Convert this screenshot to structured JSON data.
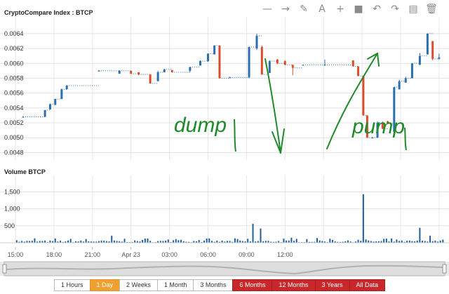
{
  "toolbar": {
    "icons": [
      "minus-icon",
      "arrow-right-icon",
      "pencil-icon",
      "text-icon",
      "plus-icon",
      "square-icon",
      "undo-icon",
      "redo-icon",
      "save-icon",
      "trash-icon"
    ],
    "glyphs": [
      "—",
      "→",
      "✎",
      "A",
      "+",
      "■",
      "↶",
      "↷",
      "▤",
      "🗑"
    ]
  },
  "price_panel": {
    "title": "CryptoCompare Index : BTCP"
  },
  "volume_panel": {
    "title": "Volume BTCP"
  },
  "annotations": {
    "left": "dump",
    "right": "pump"
  },
  "time_axis": [
    "15:00",
    "18:00",
    "21:00",
    "Apr 23",
    "03:00",
    "06:00",
    "09:00",
    "12:00"
  ],
  "range_buttons": [
    "1 Hours",
    "1 Day",
    "2 Weeks",
    "1 Month",
    "3 Months",
    "6 Months",
    "12 Months",
    "3 Years",
    "All Data"
  ],
  "active_range": "1 Day",
  "colors": {
    "up": "#2b6fb0",
    "down": "#dd4b2f",
    "volume": "#1f5f9e",
    "accent": "#f0a030",
    "range_long": "#c8282a",
    "annotation": "#1f8a2a"
  },
  "chart_data": [
    {
      "type": "candlestick",
      "title": "CryptoCompare Index : BTCP",
      "yticks": [
        "0.0048",
        "0.0050",
        "0.0052",
        "0.0054",
        "0.0056",
        "0.0058",
        "0.0060",
        "0.0062",
        "0.0064"
      ],
      "ylim": [
        0.0047,
        0.00655
      ],
      "x_hours": [
        -9,
        24.5
      ],
      "candles": [
        {
          "t": -8.4,
          "o": 0.00528,
          "c": 0.00528,
          "h": 0.00529,
          "l": 0.00527
        },
        {
          "t": -6.7,
          "o": 0.00528,
          "c": 0.00537,
          "h": 0.00537,
          "l": 0.00528
        },
        {
          "t": -6.3,
          "o": 0.00538,
          "c": 0.00545,
          "h": 0.00546,
          "l": 0.00538
        },
        {
          "t": -5.9,
          "o": 0.00544,
          "c": 0.00552,
          "h": 0.00552,
          "l": 0.00544
        },
        {
          "t": -5.4,
          "o": 0.00552,
          "c": 0.00565,
          "h": 0.00566,
          "l": 0.00552
        },
        {
          "t": -5.0,
          "o": 0.00565,
          "c": 0.0057,
          "h": 0.00571,
          "l": 0.00565
        },
        {
          "t": -2.5,
          "o": 0.0059,
          "c": 0.0059,
          "h": 0.00591,
          "l": 0.00589
        },
        {
          "t": -0.9,
          "o": 0.00586,
          "c": 0.0059,
          "h": 0.00591,
          "l": 0.00586
        },
        {
          "t": 0.0,
          "o": 0.0059,
          "c": 0.00586,
          "h": 0.0059,
          "l": 0.00586
        },
        {
          "t": 0.6,
          "o": 0.00588,
          "c": 0.00585,
          "h": 0.00588,
          "l": 0.00584
        },
        {
          "t": 1.5,
          "o": 0.00585,
          "c": 0.00573,
          "h": 0.00585,
          "l": 0.00573
        },
        {
          "t": 2.1,
          "o": 0.00576,
          "c": 0.00588,
          "h": 0.0059,
          "l": 0.00576
        },
        {
          "t": 2.6,
          "o": 0.00588,
          "c": 0.00592,
          "h": 0.00592,
          "l": 0.00588
        },
        {
          "t": 3.2,
          "o": 0.00591,
          "c": 0.00588,
          "h": 0.00591,
          "l": 0.00588
        },
        {
          "t": 4.6,
          "o": 0.0059,
          "c": 0.00595,
          "h": 0.00595,
          "l": 0.00588
        },
        {
          "t": 5.4,
          "o": 0.00597,
          "c": 0.00603,
          "h": 0.00604,
          "l": 0.00597
        },
        {
          "t": 6.0,
          "o": 0.00603,
          "c": 0.00613,
          "h": 0.00613,
          "l": 0.00602
        },
        {
          "t": 6.5,
          "o": 0.00612,
          "c": 0.00624,
          "h": 0.00624,
          "l": 0.00612
        },
        {
          "t": 6.9,
          "o": 0.00624,
          "c": 0.0058,
          "h": 0.00624,
          "l": 0.0058
        },
        {
          "t": 7.7,
          "o": 0.00581,
          "c": 0.00581,
          "h": 0.00582,
          "l": 0.00581
        },
        {
          "t": 9.2,
          "o": 0.00581,
          "c": 0.00622,
          "h": 0.00622,
          "l": 0.0058
        },
        {
          "t": 9.8,
          "o": 0.0062,
          "c": 0.00637,
          "h": 0.0064,
          "l": 0.00618
        },
        {
          "t": 10.2,
          "o": 0.00622,
          "c": 0.00585,
          "h": 0.00624,
          "l": 0.00585
        },
        {
          "t": 10.8,
          "o": 0.00587,
          "c": 0.00603,
          "h": 0.00604,
          "l": 0.00587
        },
        {
          "t": 11.4,
          "o": 0.00605,
          "c": 0.006,
          "h": 0.00606,
          "l": 0.00599
        },
        {
          "t": 12.0,
          "o": 0.00603,
          "c": 0.00598,
          "h": 0.00604,
          "l": 0.00598
        },
        {
          "t": 12.6,
          "o": 0.00598,
          "c": 0.00594,
          "h": 0.00598,
          "l": 0.00584
        },
        {
          "t": 13.4,
          "o": 0.00598,
          "c": 0.00598,
          "h": 0.00598,
          "l": 0.00597
        },
        {
          "t": 15.1,
          "o": 0.00598,
          "c": 0.00598,
          "h": 0.00605,
          "l": 0.00597
        },
        {
          "t": 17.3,
          "o": 0.00604,
          "c": 0.00596,
          "h": 0.00604,
          "l": 0.00596
        },
        {
          "t": 17.7,
          "o": 0.00596,
          "c": 0.00583,
          "h": 0.00596,
          "l": 0.00583
        },
        {
          "t": 18.1,
          "o": 0.00583,
          "c": 0.0053,
          "h": 0.00583,
          "l": 0.0053
        },
        {
          "t": 18.4,
          "o": 0.0053,
          "c": 0.005,
          "h": 0.0053,
          "l": 0.005
        },
        {
          "t": 18.8,
          "o": 0.005,
          "c": 0.005,
          "h": 0.00501,
          "l": 0.005
        },
        {
          "t": 19.2,
          "o": 0.005,
          "c": 0.0052,
          "h": 0.00522,
          "l": 0.005
        },
        {
          "t": 19.6,
          "o": 0.0052,
          "c": 0.00512,
          "h": 0.00522,
          "l": 0.00512
        },
        {
          "t": 20.0,
          "o": 0.00522,
          "c": 0.00519,
          "h": 0.00523,
          "l": 0.00518
        },
        {
          "t": 20.5,
          "o": 0.00508,
          "c": 0.00568,
          "h": 0.00568,
          "l": 0.00506
        },
        {
          "t": 20.9,
          "o": 0.00565,
          "c": 0.00576,
          "h": 0.00578,
          "l": 0.00565
        },
        {
          "t": 21.4,
          "o": 0.00574,
          "c": 0.0058,
          "h": 0.00582,
          "l": 0.00574
        },
        {
          "t": 21.9,
          "o": 0.0058,
          "c": 0.006,
          "h": 0.006,
          "l": 0.0058
        },
        {
          "t": 22.5,
          "o": 0.00598,
          "c": 0.0061,
          "h": 0.00614,
          "l": 0.00598
        },
        {
          "t": 23.1,
          "o": 0.00612,
          "c": 0.0064,
          "h": 0.0064,
          "l": 0.00612
        },
        {
          "t": 23.5,
          "o": 0.0063,
          "c": 0.00606,
          "h": 0.0063,
          "l": 0.00604
        },
        {
          "t": 24.0,
          "o": 0.00606,
          "c": 0.00608,
          "h": 0.00613,
          "l": 0.00605
        }
      ]
    },
    {
      "type": "bar",
      "title": "Volume BTCP",
      "yticks": [
        "500",
        "1,000",
        "1,500"
      ],
      "ylim": [
        0,
        1900
      ],
      "peaks": [
        [
          -7.5,
          130
        ],
        [
          -3.0,
          120
        ],
        [
          -1.5,
          210
        ],
        [
          2.0,
          160
        ],
        [
          4.0,
          180
        ],
        [
          6.0,
          400
        ],
        [
          6.6,
          330
        ],
        [
          8.0,
          230
        ],
        [
          9.5,
          560
        ],
        [
          10.1,
          420
        ],
        [
          10.6,
          230
        ],
        [
          12.5,
          150
        ],
        [
          14.5,
          140
        ],
        [
          17.6,
          650
        ],
        [
          18.1,
          1430
        ],
        [
          18.6,
          380
        ],
        [
          20.6,
          220
        ],
        [
          22.5,
          440
        ],
        [
          23.3,
          210
        ]
      ]
    }
  ]
}
